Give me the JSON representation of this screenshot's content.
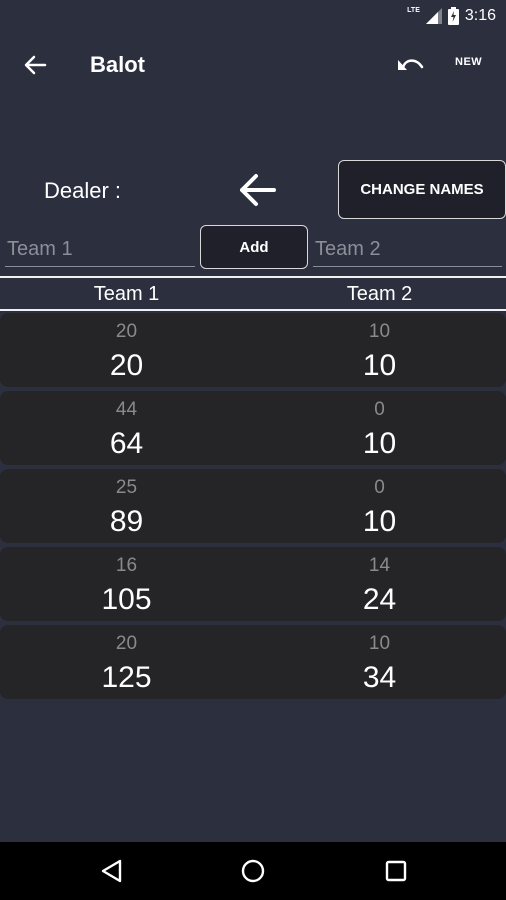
{
  "status": {
    "network": "LTE",
    "time": "3:16"
  },
  "app_bar": {
    "title": "Balot",
    "new_label": "NEW"
  },
  "dealer": {
    "label": "Dealer :",
    "change_names_label": "CHANGE NAMES"
  },
  "inputs": {
    "team1_placeholder": "Team 1",
    "add_label": "Add",
    "team2_placeholder": "Team 2"
  },
  "headers": {
    "team1": "Team 1",
    "team2": "Team 2"
  },
  "rows": [
    {
      "team1_round": "20",
      "team1_total": "20",
      "team2_round": "10",
      "team2_total": "10"
    },
    {
      "team1_round": "44",
      "team1_total": "64",
      "team2_round": "0",
      "team2_total": "10"
    },
    {
      "team1_round": "25",
      "team1_total": "89",
      "team2_round": "0",
      "team2_total": "10"
    },
    {
      "team1_round": "16",
      "team1_total": "105",
      "team2_round": "14",
      "team2_total": "24"
    },
    {
      "team1_round": "20",
      "team1_total": "125",
      "team2_round": "10",
      "team2_total": "34"
    }
  ],
  "colors": {
    "background": "#2b2f3e",
    "row": "#252527",
    "button": "#1f2029"
  }
}
